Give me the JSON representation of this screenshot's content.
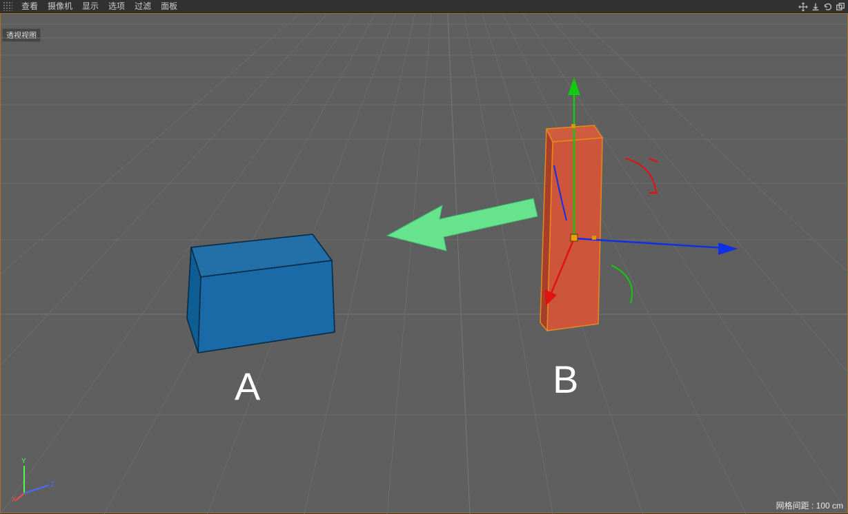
{
  "menubar": {
    "items": [
      "查看",
      "摄像机",
      "显示",
      "选项",
      "过滤",
      "面板"
    ]
  },
  "view_tab": "透视视图",
  "labels": {
    "A": "A",
    "B": "B"
  },
  "axis": {
    "y": "Y",
    "z": "Z",
    "x": "X"
  },
  "status": {
    "grid_spacing": "网格间距 : 100 cm"
  },
  "objects": {
    "A": {
      "type": "cube",
      "color": "#1a6aa8",
      "selected": false
    },
    "B": {
      "type": "cube",
      "color": "#cc553b",
      "selected": true
    }
  },
  "icon_names": {
    "move": "move-icon",
    "down": "download-icon",
    "refresh": "refresh-icon",
    "popout": "popout-icon"
  }
}
